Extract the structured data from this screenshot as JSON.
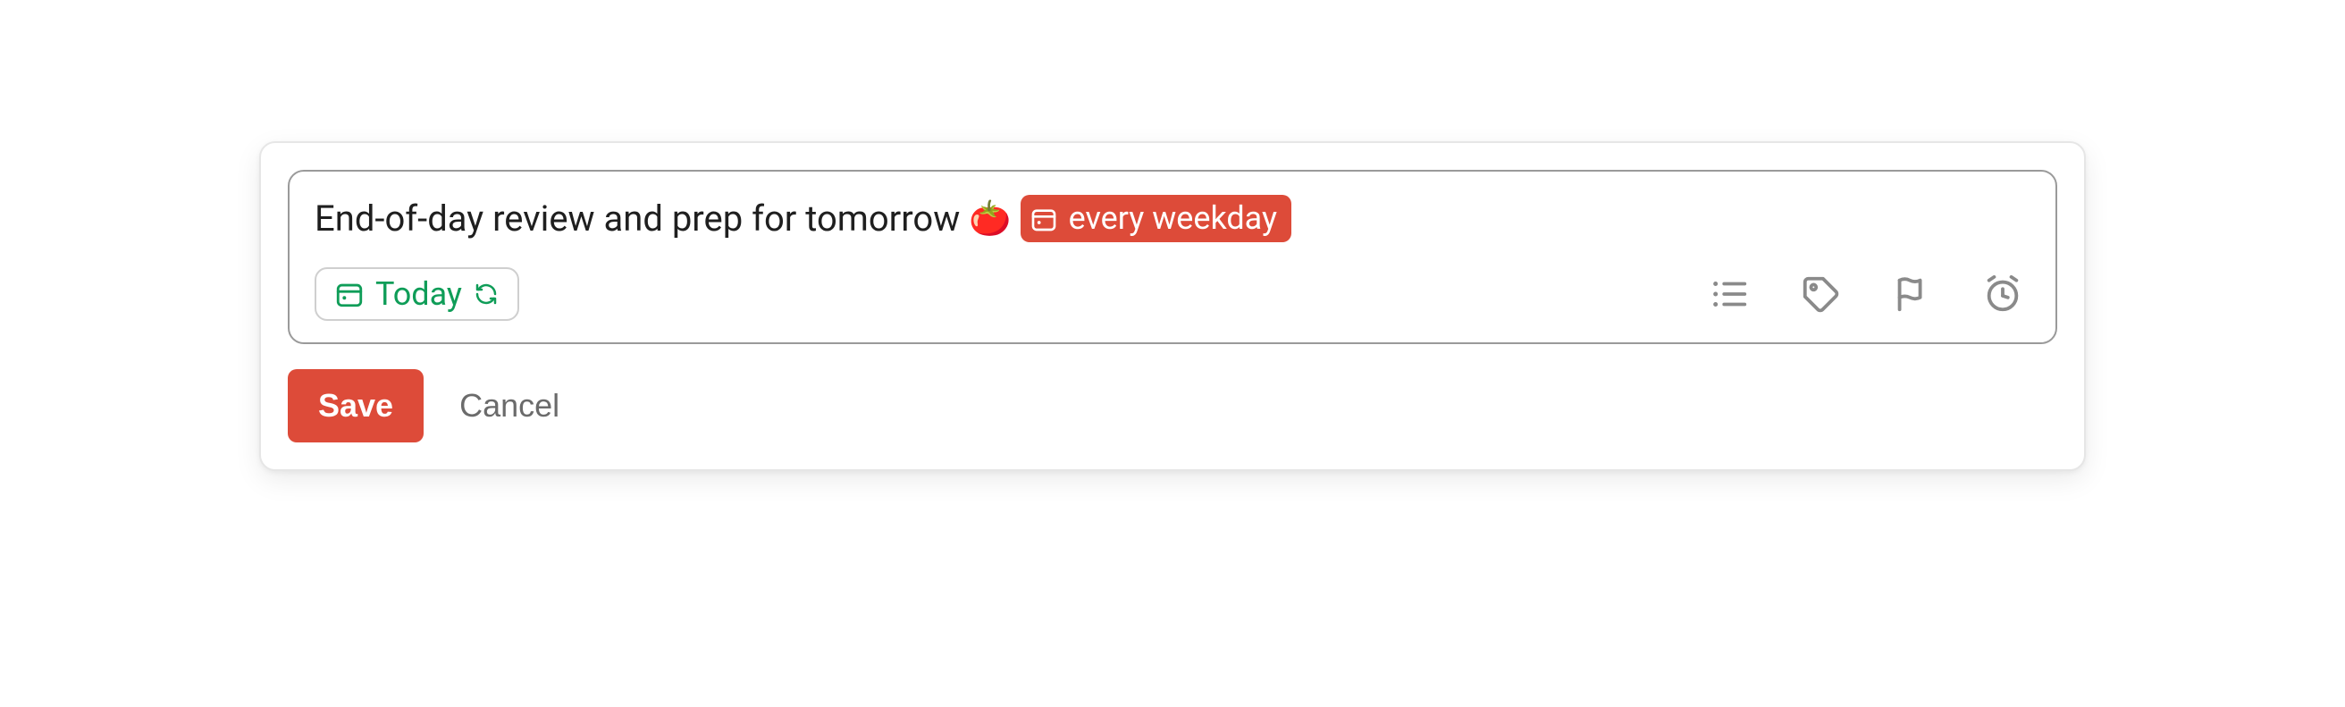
{
  "task": {
    "text": "End-of-day review and prep for tomorrow",
    "emoji": "🍅",
    "recurrence": {
      "label": "every weekday"
    }
  },
  "date_chip": {
    "label": "Today"
  },
  "buttons": {
    "save": "Save",
    "cancel": "Cancel"
  },
  "colors": {
    "accent": "#dd4b39",
    "green": "#0f9d58",
    "icon_gray": "#8a8a8a"
  }
}
